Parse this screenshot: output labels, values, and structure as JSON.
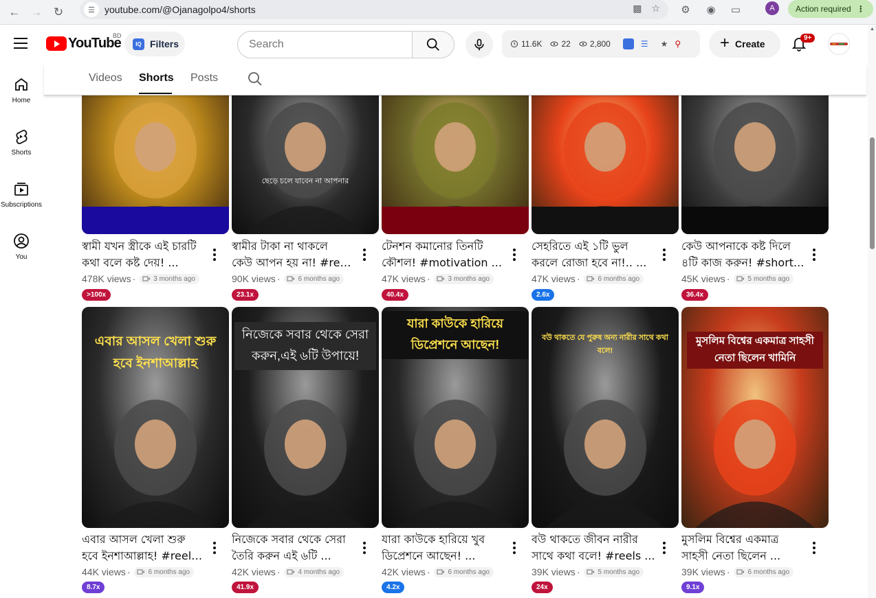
{
  "browser": {
    "url": "youtube.com/@Ojanagolpo4/shorts",
    "action_required": "Action required",
    "profile_initial": "A"
  },
  "header": {
    "logo_text": "YouTube",
    "country_code": "BD",
    "filters_label": "Filters",
    "search_placeholder": "Search",
    "stats": {
      "subscribers": "11.6K",
      "watching": "22",
      "views": "2,800"
    },
    "create_label": "Create",
    "notifications_badge": "9+"
  },
  "sidebar": {
    "items": [
      {
        "label": "Home",
        "icon": "home-icon"
      },
      {
        "label": "Shorts",
        "icon": "shorts-icon"
      },
      {
        "label": "Subscriptions",
        "icon": "subscriptions-icon"
      },
      {
        "label": "You",
        "icon": "you-icon"
      }
    ]
  },
  "tabs": {
    "videos": "Videos",
    "shorts": "Shorts",
    "posts": "Posts",
    "active": "Shorts"
  },
  "shorts": [
    {
      "title1": "স্বামী যখন স্ত্রীকে এই চারটি",
      "title2": "কথা বলে কষ্ট দেয়! ...",
      "views": "478K views",
      "age": "3 months ago",
      "vph": ">100x",
      "vph_color": "#c0143c",
      "thumb_text": "",
      "thumb_bg": "#b8861b",
      "bar_color": "#1a0a9e"
    },
    {
      "title1": "স্বামীর টাকা না থাকলে",
      "title2": "কেউ আপন হয় না! #ree...",
      "views": "90K views",
      "age": "6 months ago",
      "vph": "23.1x",
      "vph_color": "#c0143c",
      "thumb_text": "ছেড়ে চলে যাবেন না আপনার",
      "thumb_bg": "#2a2a2a",
      "bar_color": ""
    },
    {
      "title1": "টেনশন কমানোর তিনটি",
      "title2": "কৌশল! #motivation ...",
      "views": "47K views",
      "age": "3 months ago",
      "vph": "40.4x",
      "vph_color": "#c0143c",
      "thumb_text": "",
      "thumb_bg": "#6f6a2a",
      "bar_color": "#7a0010"
    },
    {
      "title1": "সেহরিতে এই ১টি ভুল",
      "title2": "করলে রোজা হবে না!.. ...",
      "views": "47K views",
      "age": "6 months ago",
      "vph": "2.6x",
      "vph_color": "#1a73e8",
      "thumb_text": "",
      "thumb_bg": "#e8431a",
      "bar_color": "#111111"
    },
    {
      "title1": "কেউ আপনাকে কষ্ট দিলে",
      "title2": "৪টি কাজ করুন! #short...",
      "views": "45K views",
      "age": "5 months ago",
      "vph": "36.4x",
      "vph_color": "#c0143c",
      "thumb_text": "",
      "thumb_bg": "#3a3a3a",
      "bar_color": "#0a0a0a"
    },
    {
      "title1": "এবার আসল খেলা শুরু",
      "title2": "হবে ইনশাআল্লাহ! #reels...",
      "views": "44K views",
      "age": "6 months ago",
      "vph": "8.7x",
      "vph_color": "#6f3fd6",
      "thumb_text": "এবার আসল খেলা শুরু হবে ইনশাআল্লাহ",
      "thumb_bg": "#2b2b2b",
      "bar_color": ""
    },
    {
      "title1": "নিজেকে সবার থেকে সেরা",
      "title2": "তৈরি করুন এই ৬টি ...",
      "views": "42K views",
      "age": "4 months ago",
      "vph": "41.9x",
      "vph_color": "#c0143c",
      "thumb_text": "নিজেকে সবার থেকে সেরা করুন,এই ৬টি উপায়ে!",
      "thumb_bg": "#1e1e1e",
      "bar_color": ""
    },
    {
      "title1": "যারা কাউকে হারিয়ে খুব",
      "title2": "ডিপ্রেশনে আছেন! ...",
      "views": "42K views",
      "age": "6 months ago",
      "vph": "4.2x",
      "vph_color": "#1a73e8",
      "thumb_text": "যারা কাউকে হারিয়ে ডিপ্রেশনে আছেন!",
      "thumb_bg": "#262626",
      "bar_color": ""
    },
    {
      "title1": "বউ থাকতে জীবন নারীর",
      "title2": "সাথে কথা বলে! #reels ...",
      "views": "39K views",
      "age": "5 months ago",
      "vph": "24x",
      "vph_color": "#c0143c",
      "thumb_text": "বউ থাকতে যে পুরুষ অন্য নারীর সাথে কথা বলে!",
      "thumb_bg": "#1a1a1a",
      "bar_color": ""
    },
    {
      "title1": "মুসলিম বিশ্বের একমাত্র",
      "title2": "সাহসী নেতা ছিলেন ...",
      "views": "39K views",
      "age": "6 months ago",
      "vph": "9.1x",
      "vph_color": "#6f3fd6",
      "thumb_text": "মুসলিম বিশ্বের একমাত্র সাহসী নেতা ছিলেন খামিনি",
      "thumb_bg": "#c73c1c",
      "bar_color": ""
    }
  ]
}
